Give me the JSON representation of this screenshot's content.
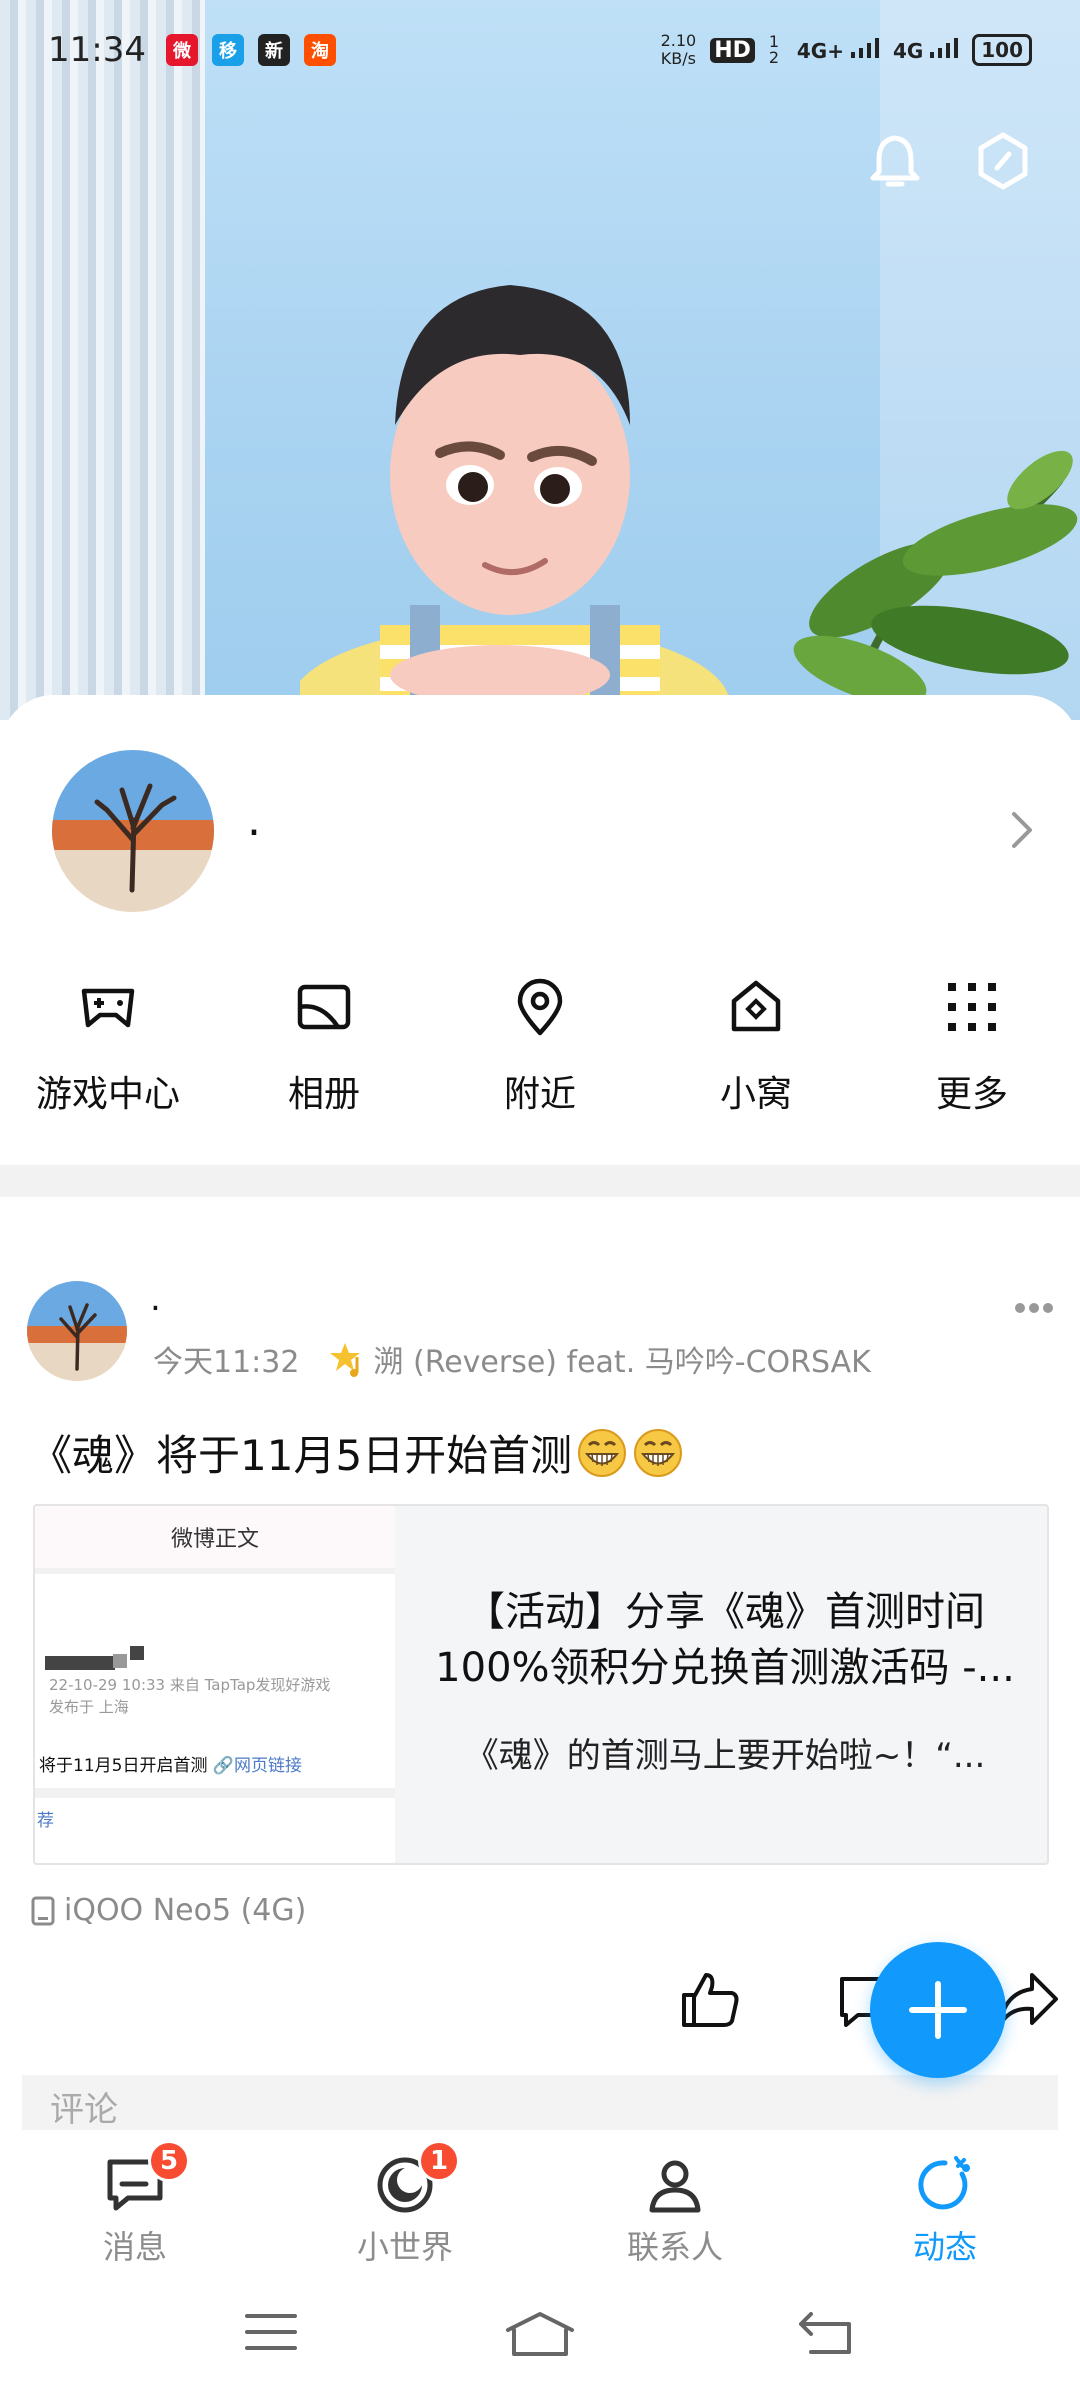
{
  "status_bar": {
    "time": "11:34",
    "apps": [
      {
        "name": "weibo-icon",
        "color": "#e6162d",
        "glyph": "微"
      },
      {
        "name": "china-mobile-icon",
        "color": "#19a0e8",
        "glyph": "移"
      },
      {
        "name": "news-app-icon",
        "color": "#222222",
        "glyph": "新"
      },
      {
        "name": "taobao-icon",
        "color": "#ff5000",
        "glyph": "淘"
      }
    ],
    "speed_value": "2.10",
    "speed_unit": "KB/s",
    "hd": "HD",
    "hd_sub": "1 2",
    "net1": "4G+",
    "net2": "4G",
    "battery": "100"
  },
  "header": {
    "notification_icon": "bell-icon",
    "settings_icon": "hexagon-settings-icon"
  },
  "profile": {
    "nickname": "."
  },
  "shortcuts": [
    {
      "label": "游戏中心",
      "icon": "gamepad-icon"
    },
    {
      "label": "相册",
      "icon": "album-icon"
    },
    {
      "label": "附近",
      "icon": "location-pin-icon"
    },
    {
      "label": "小窝",
      "icon": "small-home-icon"
    },
    {
      "label": "更多",
      "icon": "grid-more-icon"
    }
  ],
  "post": {
    "author": ".",
    "time": "今天11:32",
    "music": "溯 (Reverse) feat. 马吟吟-CORSAK",
    "text": "《魂》将于11月5日开始首测",
    "link_card": {
      "thumb_title": "微博正文",
      "thumb_date": "22-10-29 10:33  来自 TapTap发现好游戏",
      "thumb_location": "发布于 上海",
      "thumb_line": "将于11月5日开启首测",
      "thumb_link": "网页链接",
      "thumb_rec": "荐",
      "title": "【活动】分享《魂》首测时间100%领积分兑换首测激活码 -...",
      "desc": "《魂》的首测马上要开始啦~！“..."
    },
    "device": "iQOO Neo5 (4G)",
    "comment_placeholder": "评论"
  },
  "tabs": [
    {
      "label": "消息",
      "icon": "message-icon",
      "badge": "5"
    },
    {
      "label": "小世界",
      "icon": "small-world-icon",
      "badge": "1"
    },
    {
      "label": "联系人",
      "icon": "contacts-icon",
      "badge": ""
    },
    {
      "label": "动态",
      "icon": "dynamic-icon",
      "badge": ""
    }
  ],
  "colors": {
    "accent": "#119afb",
    "badge": "#f74c31",
    "muted_text": "#8b8b8b"
  }
}
